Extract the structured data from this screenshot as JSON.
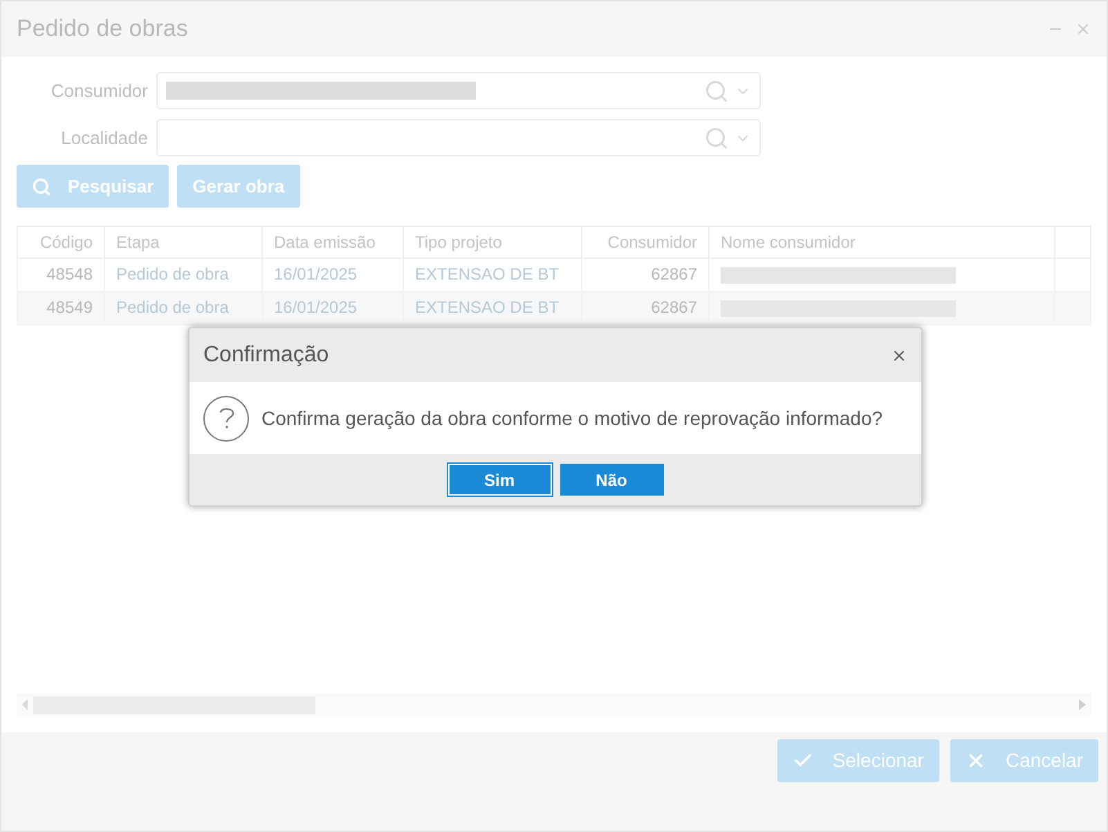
{
  "window": {
    "title": "Pedido de obras"
  },
  "form": {
    "fields": [
      {
        "label": "Consumidor",
        "redacted": true
      },
      {
        "label": "Localidade",
        "redacted": false
      }
    ]
  },
  "toolbar": [
    {
      "label": "Pesquisar",
      "kind": "search"
    },
    {
      "label": "Gerar obra",
      "kind": "plain"
    }
  ],
  "table": {
    "columns": [
      "Código",
      "Etapa",
      "Data emissão",
      "Tipo projeto",
      "Consumidor",
      "Nome consumidor"
    ],
    "rows": [
      {
        "cells": [
          "48548",
          "Pedido de obra",
          "16/01/2025",
          "EXTENSAO DE BT",
          "62867"
        ],
        "name_redacted": true
      },
      {
        "cells": [
          "48549",
          "Pedido de obra",
          "16/01/2025",
          "EXTENSAO DE BT",
          "62867"
        ],
        "name_redacted": true
      }
    ]
  },
  "footer": [
    {
      "label": "Selecionar",
      "kind": "check"
    },
    {
      "label": "Cancelar",
      "kind": "cancel"
    }
  ],
  "dialog": {
    "title": "Confirmação",
    "message": "Confirma geração da obra conforme o motivo de reprovação informado?",
    "buttons": [
      {
        "label": "Sim",
        "focused": true
      },
      {
        "label": "Não",
        "focused": false
      }
    ]
  }
}
